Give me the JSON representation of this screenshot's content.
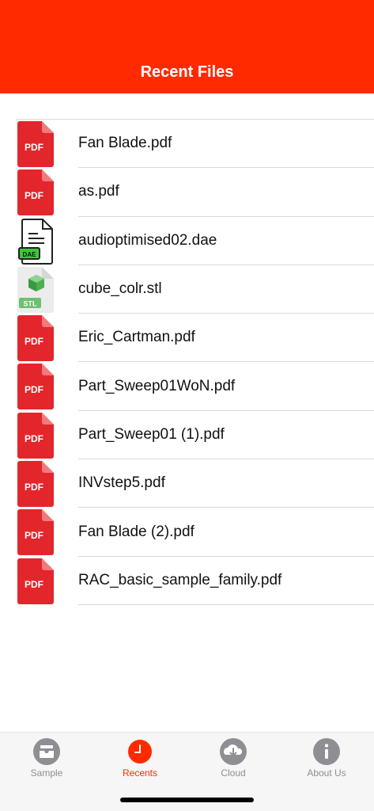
{
  "header": {
    "title": "Recent Files",
    "color": "#ff2a00"
  },
  "files": [
    {
      "name": "Fan Blade.pdf",
      "type": "pdf",
      "badge": "PDF"
    },
    {
      "name": "as.pdf",
      "type": "pdf",
      "badge": "PDF"
    },
    {
      "name": "audioptimised02.dae",
      "type": "dae",
      "badge": "DAE"
    },
    {
      "name": "cube_colr.stl",
      "type": "stl",
      "badge": "STL"
    },
    {
      "name": "Eric_Cartman.pdf",
      "type": "pdf",
      "badge": "PDF"
    },
    {
      "name": "Part_Sweep01WoN.pdf",
      "type": "pdf",
      "badge": "PDF"
    },
    {
      "name": "Part_Sweep01 (1).pdf",
      "type": "pdf",
      "badge": "PDF"
    },
    {
      "name": "INVstep5.pdf",
      "type": "pdf",
      "badge": "PDF"
    },
    {
      "name": "Fan Blade (2).pdf",
      "type": "pdf",
      "badge": "PDF"
    },
    {
      "name": "RAC_basic_sample_family.pdf",
      "type": "pdf",
      "badge": "PDF"
    }
  ],
  "tabs": [
    {
      "label": "Sample",
      "icon": "inbox-icon",
      "active": false
    },
    {
      "label": "Recents",
      "icon": "clock-icon",
      "active": true
    },
    {
      "label": "Cloud",
      "icon": "cloud-download-icon",
      "active": false
    },
    {
      "label": "About Us",
      "icon": "info-icon",
      "active": false
    }
  ]
}
